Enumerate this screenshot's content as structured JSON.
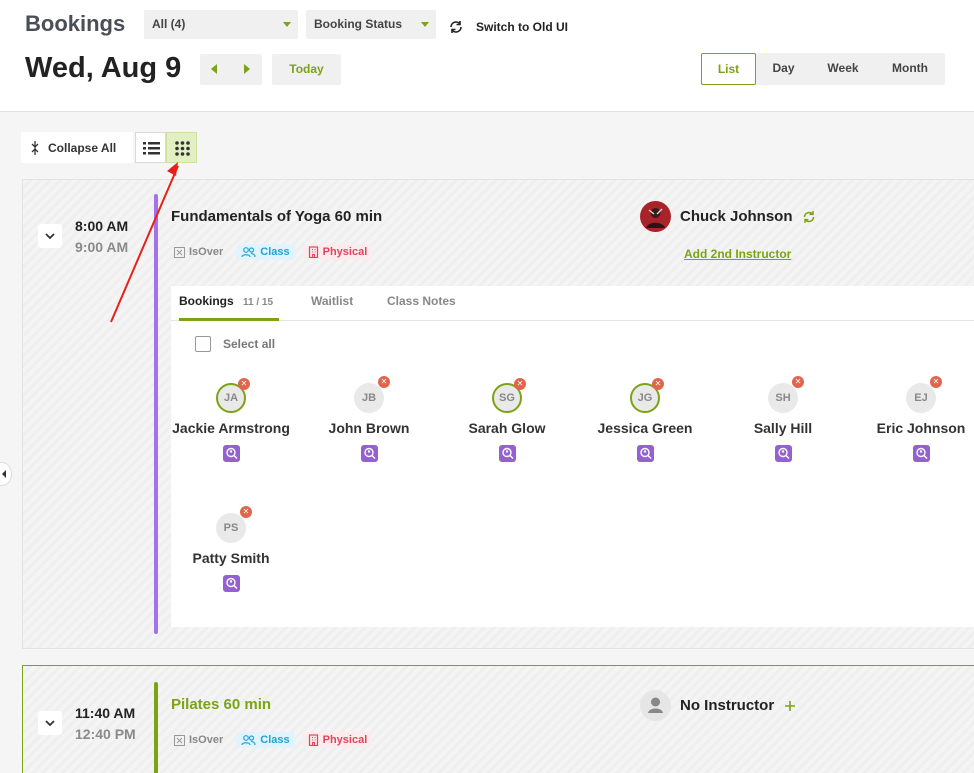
{
  "header": {
    "title": "Bookings",
    "filter_all": "All (4)",
    "filter_status": "Booking Status",
    "switch_label": "Switch to Old UI",
    "date": "Wed, Aug 9",
    "today_label": "Today",
    "views": [
      "List",
      "Day",
      "Week",
      "Month"
    ],
    "active_view": "List"
  },
  "toolbar": {
    "collapse_label": "Collapse All"
  },
  "colors": {
    "accent": "#7ba314",
    "purple": "#a371e8",
    "class_blue": "#1ea5d8",
    "physical_red": "#e2435a",
    "remove_red": "#e1654c"
  },
  "sessions": [
    {
      "start": "8:00 AM",
      "end": "9:00 AM",
      "name": "Fundamentals of Yoga 60 min",
      "tags": [
        "IsOver",
        "Class",
        "Physical"
      ],
      "instructor": "Chuck Johnson",
      "add_instructor": "Add 2nd Instructor",
      "tabs": [
        {
          "label": "Bookings",
          "count": "11 / 15"
        },
        {
          "label": "Waitlist"
        },
        {
          "label": "Class Notes"
        }
      ],
      "select_all": "Select all",
      "bookings": [
        {
          "initials": "JA",
          "name": "Jackie Armstrong",
          "ring": true
        },
        {
          "initials": "JB",
          "name": "John Brown",
          "ring": false
        },
        {
          "initials": "SG",
          "name": "Sarah Glow",
          "ring": true
        },
        {
          "initials": "JG",
          "name": "Jessica Green",
          "ring": true
        },
        {
          "initials": "SH",
          "name": "Sally Hill",
          "ring": false
        },
        {
          "initials": "EJ",
          "name": "Eric Johnson",
          "ring": false
        },
        {
          "initials": "PS",
          "name": "Patty Smith",
          "ring": false
        }
      ]
    },
    {
      "start": "11:40 AM",
      "end": "12:40 PM",
      "name": "Pilates 60 min",
      "tags": [
        "IsOver",
        "Class",
        "Physical"
      ],
      "instructor": "No Instructor"
    }
  ]
}
